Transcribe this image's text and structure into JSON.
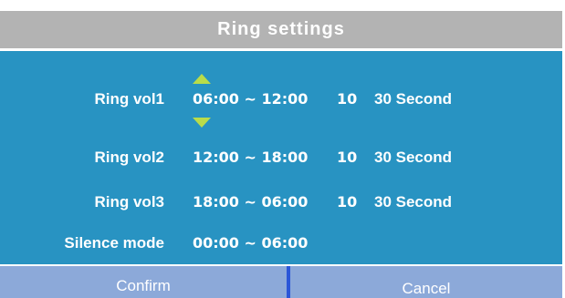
{
  "title": "Ring settings",
  "rows": [
    {
      "label": "Ring vol1",
      "time": "06:00 ~ 12:00",
      "volume": "10",
      "duration": "30 Second"
    },
    {
      "label": "Ring vol2",
      "time": "12:00 ~ 18:00",
      "volume": "10",
      "duration": "30 Second"
    },
    {
      "label": "Ring vol3",
      "time": "18:00 ~ 06:00",
      "volume": "10",
      "duration": "30 Second"
    },
    {
      "label": "Silence mode",
      "time": "00:00 ~ 06:00"
    }
  ],
  "buttons": {
    "confirm": "Confirm",
    "cancel": "Cancel"
  },
  "colors": {
    "title_bar": "#b3b3b3",
    "panel": "#2893c2",
    "arrows": "#b9dc4a",
    "bottom_bar": "#8ca9d9",
    "divider": "#2b56d8"
  },
  "icons": [
    "arrow-up-icon",
    "arrow-down-icon"
  ]
}
